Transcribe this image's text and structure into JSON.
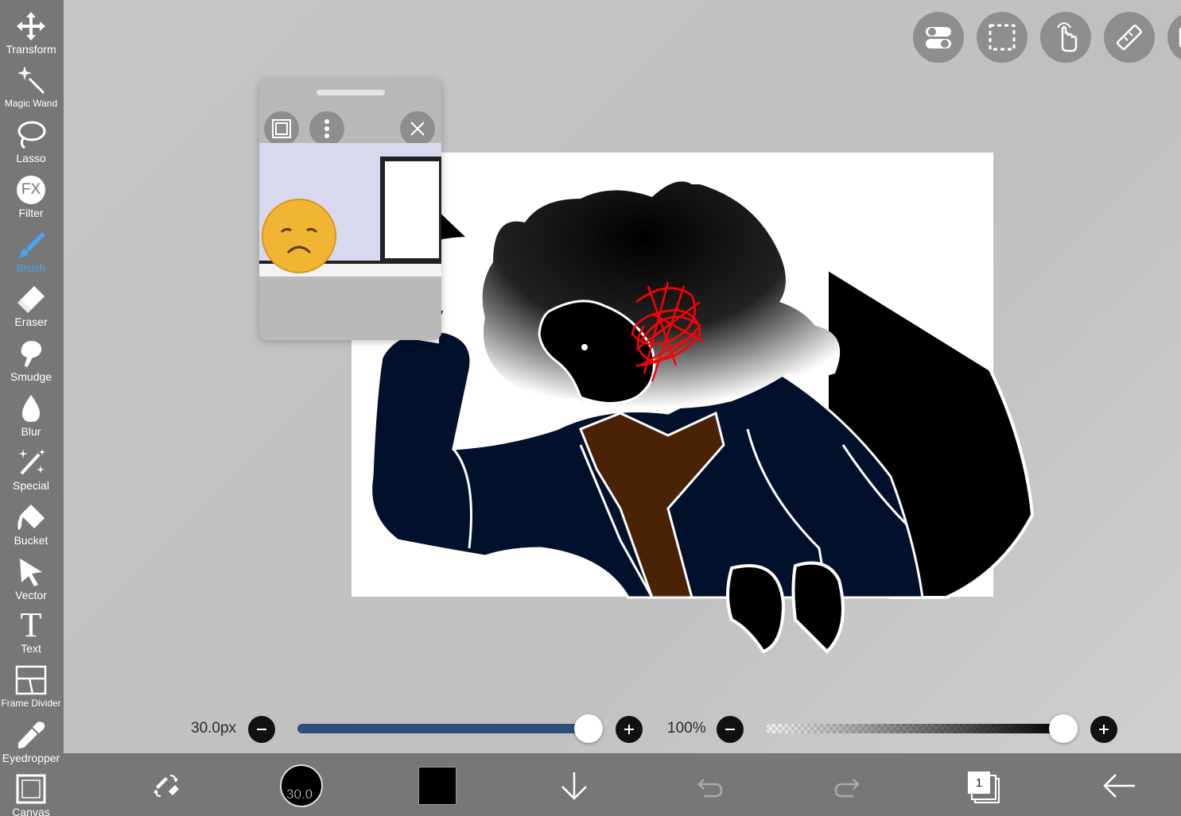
{
  "toolbar": {
    "items": [
      {
        "label": "Transform",
        "icon": "move-arrows-icon"
      },
      {
        "label": "Magic Wand",
        "icon": "magic-wand-icon"
      },
      {
        "label": "Lasso",
        "icon": "lasso-icon"
      },
      {
        "label": "Filter",
        "icon": "fx-icon"
      },
      {
        "label": "Brush",
        "icon": "brush-icon",
        "active": true
      },
      {
        "label": "Eraser",
        "icon": "eraser-icon"
      },
      {
        "label": "Smudge",
        "icon": "smudge-icon"
      },
      {
        "label": "Blur",
        "icon": "droplet-icon"
      },
      {
        "label": "Special",
        "icon": "sparkle-pen-icon"
      },
      {
        "label": "Bucket",
        "icon": "bucket-icon"
      },
      {
        "label": "Vector",
        "icon": "cursor-arrow-icon"
      },
      {
        "label": "Text",
        "icon": "text-t-icon"
      },
      {
        "label": "Frame Divider",
        "icon": "frame-divider-icon"
      },
      {
        "label": "Eyedropper",
        "icon": "eyedropper-icon"
      },
      {
        "label": "Canvas",
        "icon": "canvas-icon"
      }
    ],
    "fx_glyph": "FX",
    "text_glyph": "T"
  },
  "top_buttons": [
    "toggle-switches-icon",
    "selection-marquee-icon",
    "touch-hand-icon",
    "ruler-icon",
    "layer-more-icon"
  ],
  "brush": {
    "size_label": "30.0px",
    "size_fraction": 1.0,
    "opacity_label": "100%",
    "opacity_fraction": 1.0
  },
  "bottom_bar": {
    "brush_size_badge": "30.0",
    "current_color": "#000000",
    "layer_count": "1"
  },
  "colors": {
    "toolbar_bg": "#777777",
    "active_tool": "#4aa3f0",
    "size_slider": "#2c4f7c",
    "jacket": "#02112b",
    "scarf": "#4a2205",
    "scribble": "#ff0000"
  }
}
